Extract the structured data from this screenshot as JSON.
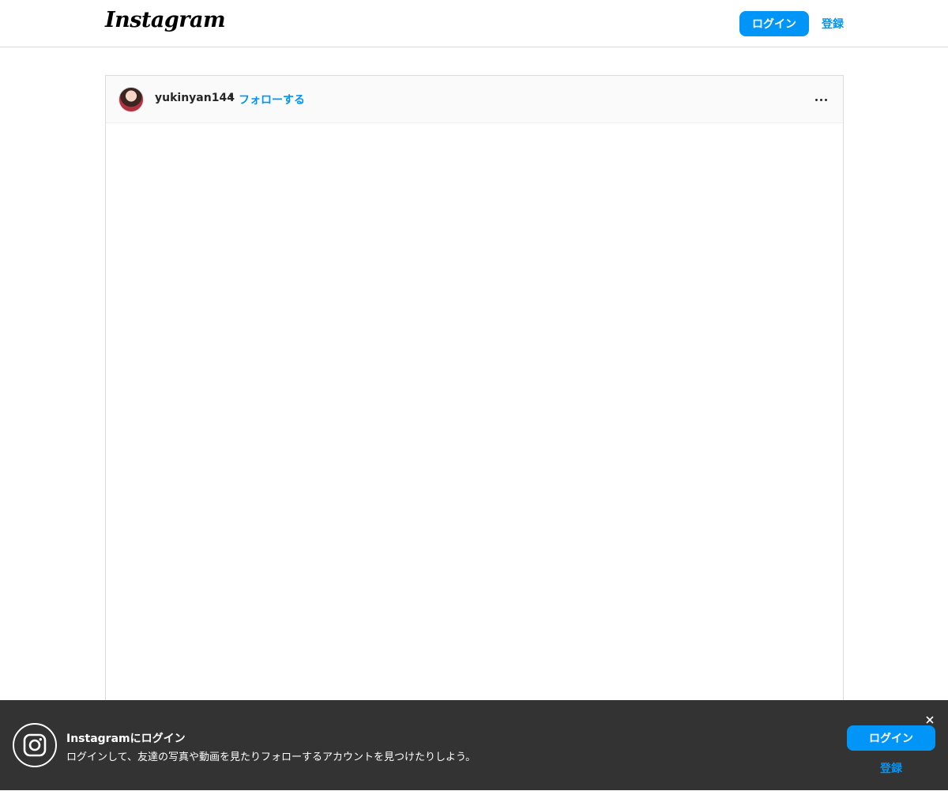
{
  "header": {
    "logo_text": "Instagram",
    "login_label": "ログイン",
    "signup_label": "登録"
  },
  "post": {
    "username": "yukinyan144",
    "separator": "•",
    "follow_label": "フォローする",
    "avatar_icon": "avatar-photo",
    "more_icon": "more-options-icon"
  },
  "login_banner": {
    "title": "Instagramにログイン",
    "subtitle": "ログインして、友達の写真や動画を見たりフォローするアカウントを見つけたりしよう。",
    "login_label": "ログイン",
    "signup_label": "登録",
    "close_icon": "close-icon",
    "app_icon": "instagram-camera-icon"
  },
  "colors": {
    "accent": "#0095f6",
    "banner_bg": "#333333",
    "border": "#dbdbdb"
  }
}
